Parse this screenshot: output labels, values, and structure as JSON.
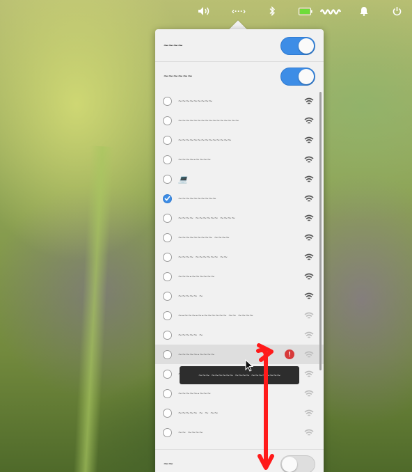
{
  "topbar": {
    "icons": [
      {
        "name": "volume-icon"
      },
      {
        "name": "network-icon",
        "label": "‹···›"
      },
      {
        "name": "bluetooth-icon"
      },
      {
        "name": "battery-icon"
      },
      {
        "name": "clock-redacted"
      },
      {
        "name": "notifications-icon"
      },
      {
        "name": "power-icon"
      }
    ]
  },
  "popover": {
    "airplane_label": "~~~~",
    "wireless_label": "~~~~~~",
    "bottom_label": "~~",
    "airplane_enabled": true,
    "wireless_enabled": true,
    "bottom_enabled": false
  },
  "networks": [
    {
      "ssid": "~~~~~~~~~",
      "selected": false,
      "signal": "full"
    },
    {
      "ssid": "~~~~~~~~~~~~~~~~",
      "selected": false,
      "signal": "full"
    },
    {
      "ssid": "~~~~~~~~~~~~~~",
      "selected": false,
      "signal": "full"
    },
    {
      "ssid": "~~~~-~~~~",
      "selected": false,
      "signal": "full"
    },
    {
      "ssid": "",
      "selected": false,
      "signal": "full",
      "icon": "laptop-icon",
      "icon_glyph": "💻"
    },
    {
      "ssid": "~~~~~~~~~~",
      "selected": true,
      "signal": "full"
    },
    {
      "ssid": "~~~~ ~~~~~~ ~~~~",
      "selected": false,
      "signal": "full"
    },
    {
      "ssid": "~~~~~~~~~ ~~~~",
      "selected": false,
      "signal": "full"
    },
    {
      "ssid": "~~~~ ~~~~~~ ~~",
      "selected": false,
      "signal": "full"
    },
    {
      "ssid": "~~~-~~~~~~",
      "selected": false,
      "signal": "full"
    },
    {
      "ssid": "~~~~~ ~",
      "selected": false,
      "signal": "full"
    },
    {
      "ssid": "~-~~~-~-~~~~~~ ~~ ~~~~",
      "selected": false,
      "signal": "weak"
    },
    {
      "ssid": "~~~~~ ~",
      "selected": false,
      "signal": "weak"
    },
    {
      "ssid": "~~~~~-~~~~",
      "selected": false,
      "signal": "weak",
      "hovered": true,
      "warning": "!"
    },
    {
      "ssid": "~~~~~~~~~~",
      "selected": false,
      "signal": "weak"
    },
    {
      "ssid": "~~~~~-~~~",
      "selected": false,
      "signal": "weak"
    },
    {
      "ssid": "~~~~~ ~ ~ ~~",
      "selected": false,
      "signal": "weak"
    },
    {
      "ssid": "~~ ~~~~",
      "selected": false,
      "signal": "weak"
    }
  ],
  "tooltip": {
    "text": "~~~ ~~~~~~ ~~~~ ~~~~~~~~"
  },
  "colors": {
    "accent": "#3d8de6",
    "warning": "#d73a3a",
    "annotation": "#ff1a1a"
  }
}
